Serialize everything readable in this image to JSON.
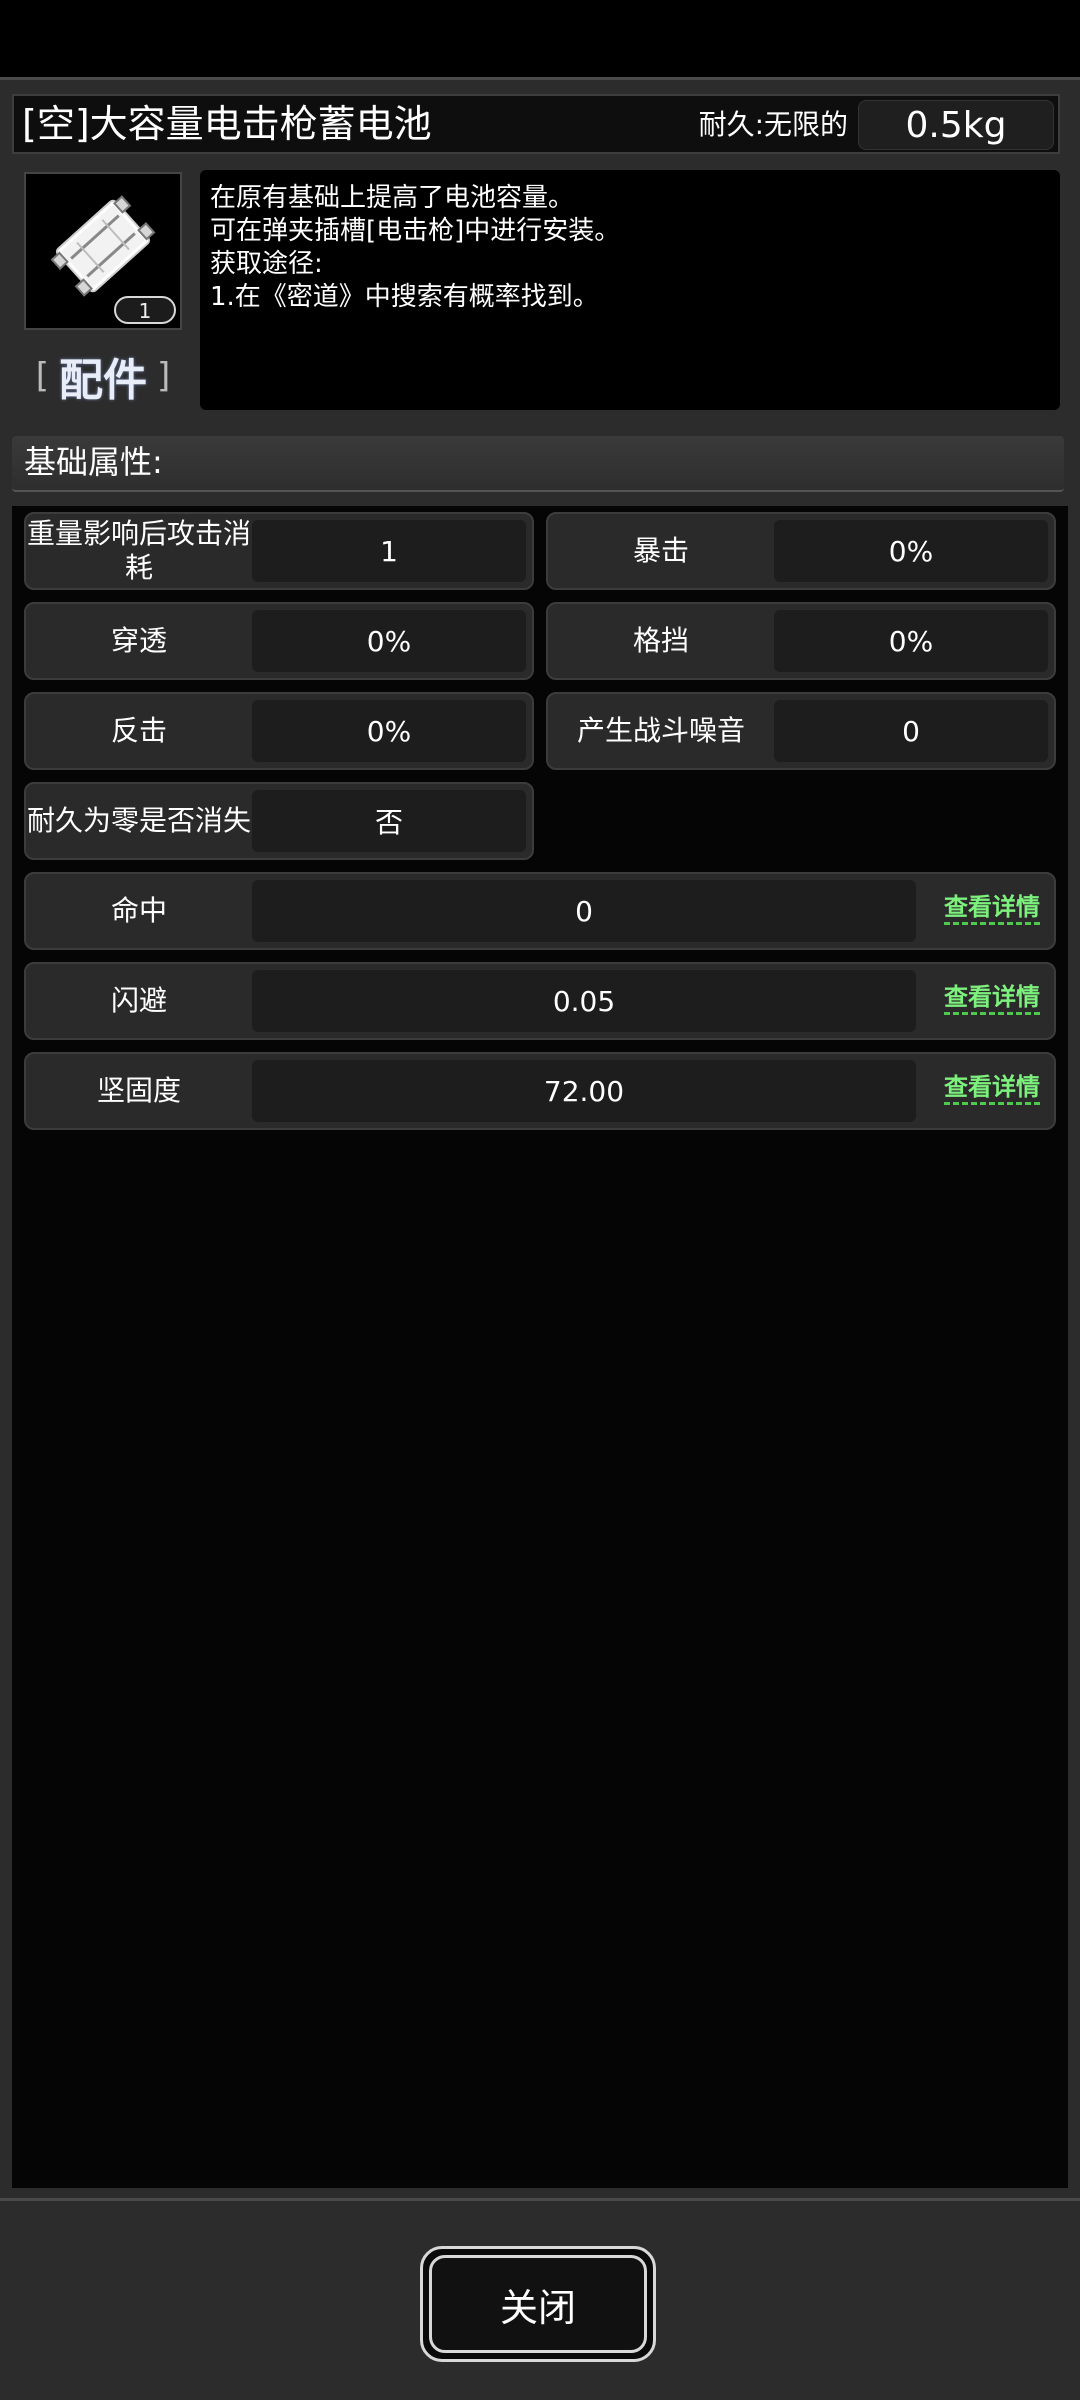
{
  "item": {
    "title": "[空]大容量电击枪蓄电池",
    "durability": "耐久:无限的",
    "weight": "0.5kg",
    "quantity": "1",
    "category": "配件"
  },
  "description": [
    "在原有基础上提高了电池容量。",
    "可在弹夹插槽[电击枪]中进行安装。",
    "获取途径:",
    "1.在《密道》中搜索有概率找到。"
  ],
  "section_title": "基础属性:",
  "stats": {
    "weight_attack": {
      "label": "重量影响后攻击消耗",
      "value": "1"
    },
    "crit": {
      "label": "暴击",
      "value": "0%"
    },
    "penetration": {
      "label": "穿透",
      "value": "0%"
    },
    "block": {
      "label": "格挡",
      "value": "0%"
    },
    "counter": {
      "label": "反击",
      "value": "0%"
    },
    "noise": {
      "label": "产生战斗噪音",
      "value": "0"
    },
    "vanish": {
      "label": "耐久为零是否消失",
      "value": "否"
    }
  },
  "wide_stats": [
    {
      "label": "命中",
      "value": "0",
      "link": "查看详情"
    },
    {
      "label": "闪避",
      "value": "0.05",
      "link": "查看详情"
    },
    {
      "label": "坚固度",
      "value": "72.00",
      "link": "查看详情"
    }
  ],
  "close_label": "关闭",
  "icon": "battery-pack-icon"
}
